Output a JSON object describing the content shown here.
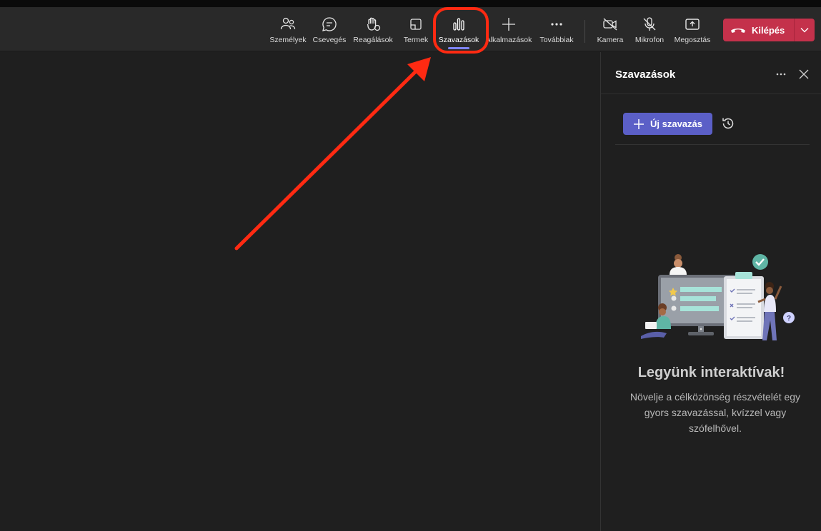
{
  "toolbar": {
    "items": [
      {
        "label": "Személyek",
        "icon": "people-icon"
      },
      {
        "label": "Csevegés",
        "icon": "chat-icon"
      },
      {
        "label": "Reagálások",
        "icon": "raise-hand-icon"
      },
      {
        "label": "Termek",
        "icon": "rooms-icon"
      },
      {
        "label": "Szavazások",
        "icon": "polls-icon",
        "active": true
      },
      {
        "label": "Alkalmazások",
        "icon": "plus-icon"
      },
      {
        "label": "Továbbiak",
        "icon": "more-icon"
      },
      {
        "label": "Kamera",
        "icon": "camera-off-icon"
      },
      {
        "label": "Mikrofon",
        "icon": "mic-off-icon"
      },
      {
        "label": "Megosztás",
        "icon": "share-icon"
      }
    ],
    "leave_label": "Kilépés"
  },
  "panel": {
    "title": "Szavazások",
    "new_poll_label": "Új szavazás",
    "empty_title": "Legyünk interaktívak!",
    "empty_description": "Növelje a célközönség részvételét egy gyors szavazással, kvízzel vagy szófelhővel."
  },
  "colors": {
    "accent": "#5b5fc7",
    "leave": "#c4314b",
    "annotation": "#ff2a12",
    "active_underline": "#7f85f5"
  }
}
